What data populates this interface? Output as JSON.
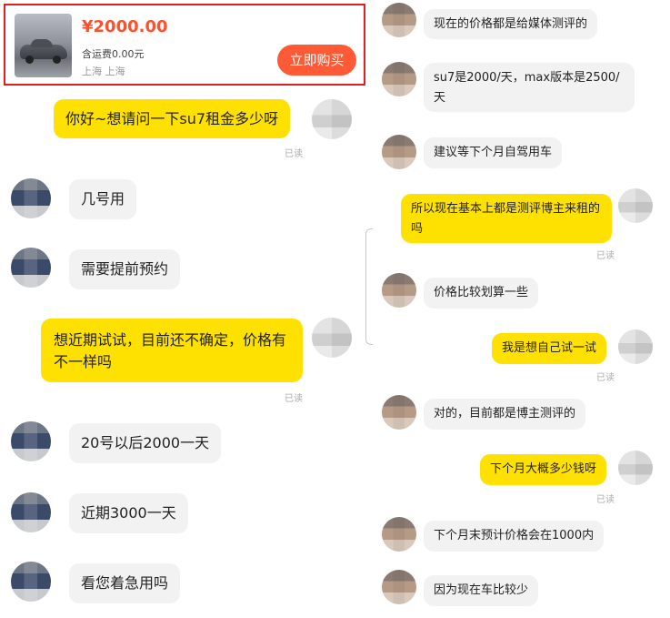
{
  "product": {
    "price": "¥2000.00",
    "shipping": "含运费0.00元",
    "location": "上海 上海",
    "buy_label": "立即购买",
    "accent_color": "#ff5a36",
    "price_color": "#ff4f2c",
    "image_icon": "car-photo"
  },
  "left_chat": {
    "messages": [
      {
        "side": "out",
        "text": "你好~想请问一下su7租金多少呀",
        "status": "已读"
      },
      {
        "side": "in",
        "text": "几号用"
      },
      {
        "side": "in",
        "text": "需要提前预约"
      },
      {
        "side": "out",
        "text": "想近期试试，目前还不确定，价格有不一样吗",
        "status": "已读"
      },
      {
        "side": "in",
        "text": "20号以后2000一天"
      },
      {
        "side": "in",
        "text": "近期3000一天"
      },
      {
        "side": "in",
        "text": "看您着急用吗"
      }
    ]
  },
  "right_chat": {
    "messages": [
      {
        "side": "in",
        "text": "现在的价格都是给媒体测评的"
      },
      {
        "side": "in",
        "text": "su7是2000/天，max版本是2500/天"
      },
      {
        "side": "in",
        "text": "建议等下个月自驾用车"
      },
      {
        "side": "out",
        "text": "所以现在基本上都是测评博主来租的吗",
        "status": "已读"
      },
      {
        "side": "in",
        "text": "价格比较划算一些"
      },
      {
        "side": "out",
        "text": "我是想自己试一试",
        "status": "已读"
      },
      {
        "side": "in",
        "text": "对的，目前都是博主测评的"
      },
      {
        "side": "out",
        "text": "下个月大概多少钱呀",
        "status": "已读"
      },
      {
        "side": "in",
        "text": "下个月末预计价格会在1000内"
      },
      {
        "side": "in",
        "text": "因为现在车比较少"
      }
    ]
  },
  "colors": {
    "outgoing_bubble": "#ffe101",
    "incoming_bubble": "#f2f2f2",
    "highlight_border": "#e02020"
  }
}
